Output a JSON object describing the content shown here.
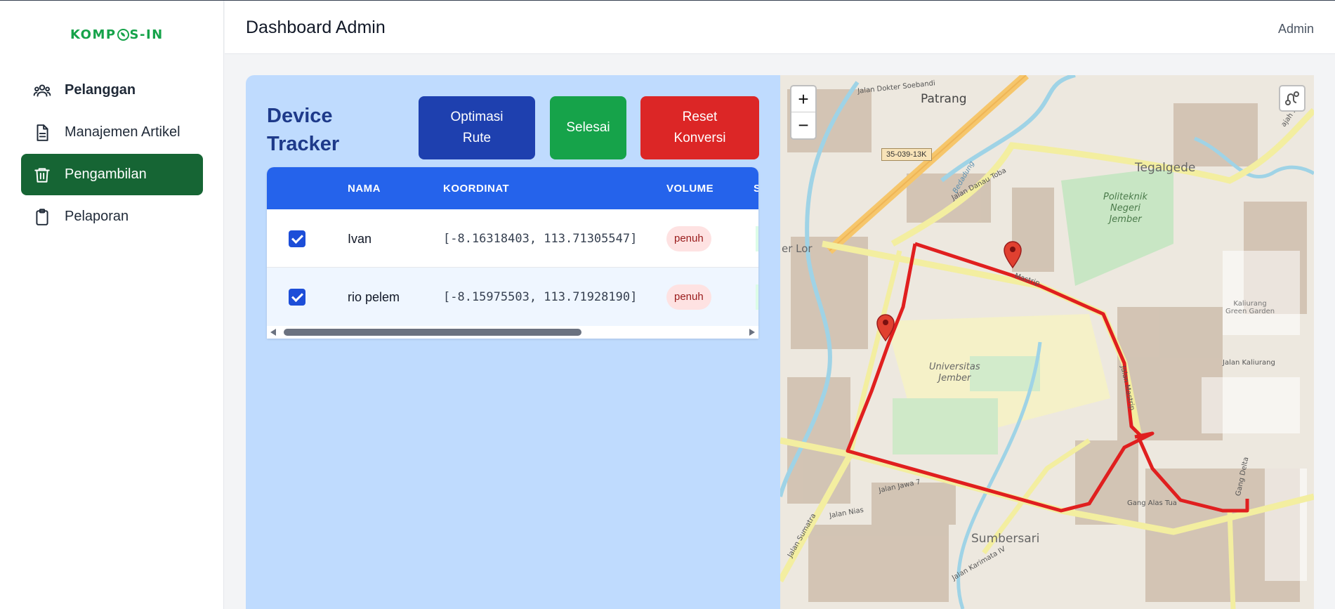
{
  "app": {
    "logo_left": "KOMP",
    "logo_right": "S-IN",
    "brand_color": "#16a34a"
  },
  "sidebar": {
    "items": [
      {
        "label": "Pelanggan",
        "icon": "users-icon"
      },
      {
        "label": "Manajemen Artikel",
        "icon": "document-icon"
      },
      {
        "label": "Pengambilan",
        "icon": "trash-icon",
        "active": true
      },
      {
        "label": "Pelaporan",
        "icon": "clipboard-icon"
      }
    ],
    "active_color": "#166534"
  },
  "header": {
    "title": "Dashboard Admin",
    "user": "Admin"
  },
  "tracker": {
    "heading_line1": "Device",
    "heading_line2": "Tracker",
    "buttons": {
      "optimasi_line1": "Optimasi",
      "optimasi_line2": "Rute",
      "selesai": "Selesai",
      "reset_line1": "Reset",
      "reset_line2": "Konversi"
    },
    "columns": [
      "NAMA",
      "KOORDINAT",
      "VOLUME",
      "S"
    ],
    "rows": [
      {
        "checked": true,
        "nama": "Ivan",
        "koordinat": "[-8.16318403, 113.71305547]",
        "volume": "penuh"
      },
      {
        "checked": true,
        "nama": "rio pelem",
        "koordinat": "[-8.15975503, 113.71928190]",
        "volume": "penuh"
      }
    ]
  },
  "map": {
    "zoom_in": "+",
    "zoom_out": "−",
    "labels": {
      "patrang": "Patrang",
      "tegalgede": "Tegalgede",
      "politeknik": "Politeknik\nNegeri\nJember",
      "universitas": "Universitas\nJember",
      "sumbersari": "Sumbersari",
      "kaliurang": "Kaliurang\nGreen Garden",
      "shield": "35-039-13K",
      "jalan_mastrip": "Mastrip",
      "jalan_danau_toba": "Jalan Danau Toba",
      "jalan_dokter": "Jalan Dokter Soebandi",
      "gang_alas_tua": "Gang Alas Tua",
      "er_lor": "er Lor",
      "bedadung": "Bedadung",
      "jalan_mastrip_v": "Jalan Mastrip",
      "jalan_kaliurang": "Jalan Kaliurang",
      "jalan_sumatra": "Jalan Sumatra",
      "jalan_nias": "Jalan Nias",
      "jalan_jawa": "Jalan Jawa 7",
      "jalan_karimata": "Jalan Karimata IV",
      "gang_delta": "Gang Delta",
      "gajah_mada": "ajah Mada"
    }
  }
}
